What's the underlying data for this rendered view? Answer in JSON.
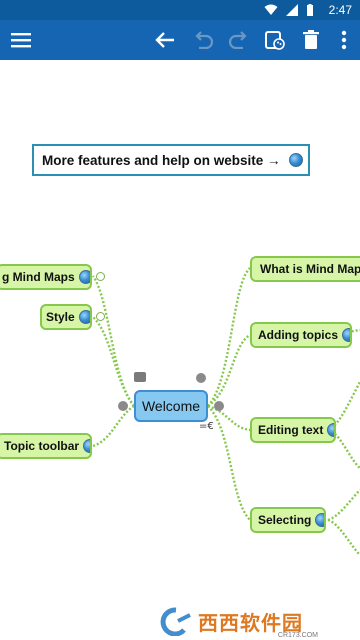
{
  "status_bar": {
    "time": "2:47"
  },
  "toolbar": {
    "icons": [
      "menu-icon",
      "back-arrow-icon",
      "undo-icon",
      "redo-icon",
      "style-palette-icon",
      "trash-icon",
      "more-vert-icon"
    ]
  },
  "canvas": {
    "info_box": {
      "text": "More features and help on website →"
    },
    "central_topic": {
      "label": "Welcome"
    },
    "left_topics": [
      {
        "label": "g Mind Maps"
      },
      {
        "label": "Style"
      },
      {
        "label": "Topic toolbar"
      }
    ],
    "right_topics": [
      {
        "label": "What is Mind Mapp"
      },
      {
        "label": "Adding topics"
      },
      {
        "label": "Editing text"
      },
      {
        "label": "Selecting"
      }
    ]
  },
  "watermark": {
    "brand": "西西软件园",
    "url": "CR173.COM"
  }
}
